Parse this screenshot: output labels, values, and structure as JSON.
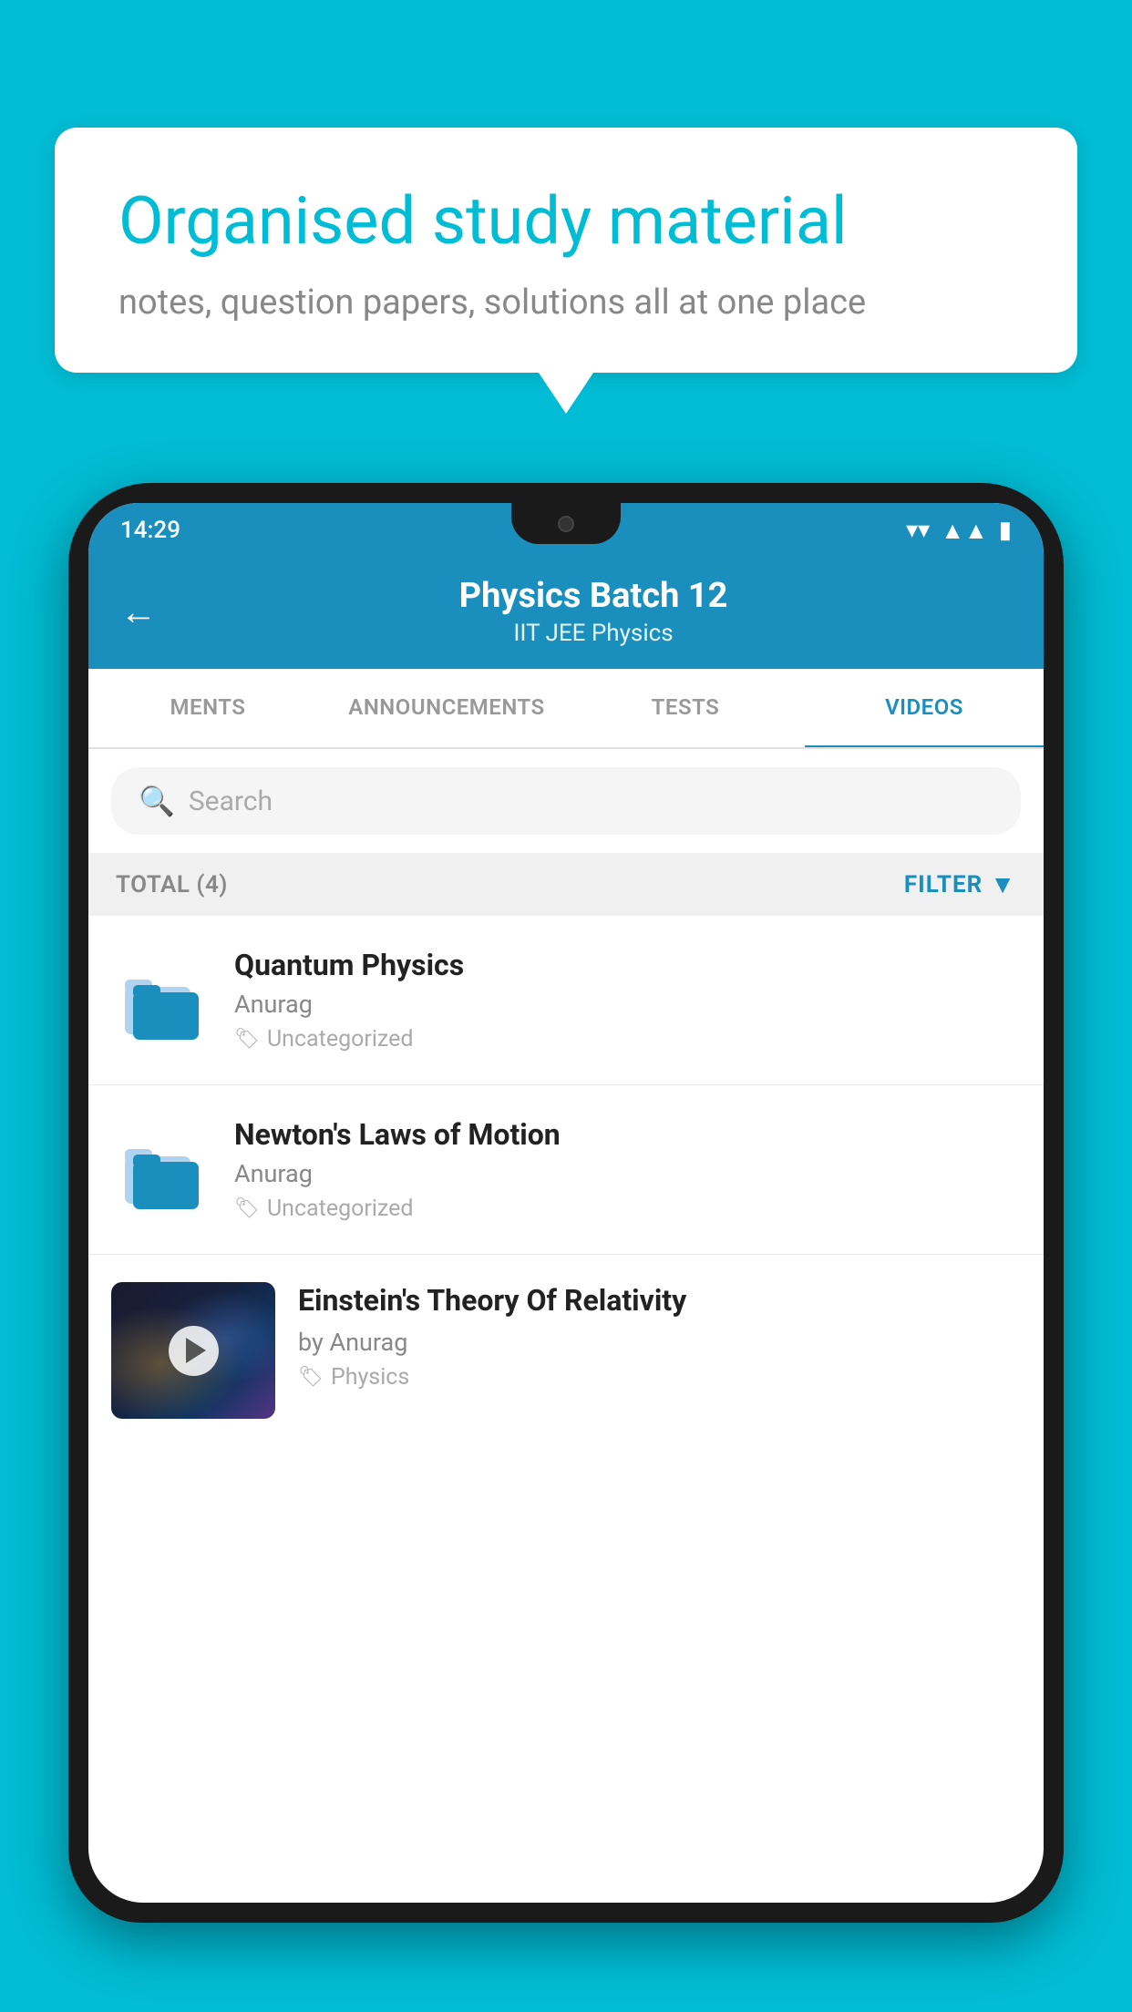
{
  "background": {
    "color": "#00BCD4"
  },
  "speech_bubble": {
    "title": "Organised study material",
    "subtitle": "notes, question papers, solutions all at one place"
  },
  "phone": {
    "status_bar": {
      "time": "14:29",
      "wifi": "▾",
      "signal": "▲",
      "battery": "▮"
    },
    "header": {
      "back_label": "←",
      "title": "Physics Batch 12",
      "subtitle": "IIT JEE   Physics"
    },
    "tabs": [
      {
        "label": "MENTS",
        "active": false
      },
      {
        "label": "ANNOUNCEMENTS",
        "active": false
      },
      {
        "label": "TESTS",
        "active": false
      },
      {
        "label": "VIDEOS",
        "active": true
      }
    ],
    "search": {
      "placeholder": "Search"
    },
    "filter_bar": {
      "total_label": "TOTAL (4)",
      "filter_label": "FILTER"
    },
    "videos": [
      {
        "id": 1,
        "title": "Quantum Physics",
        "author": "Anurag",
        "category": "Uncategorized",
        "has_thumbnail": false
      },
      {
        "id": 2,
        "title": "Newton's Laws of Motion",
        "author": "Anurag",
        "category": "Uncategorized",
        "has_thumbnail": false
      },
      {
        "id": 3,
        "title": "Einstein's Theory Of Relativity",
        "author": "by Anurag",
        "category": "Physics",
        "has_thumbnail": true
      }
    ]
  }
}
